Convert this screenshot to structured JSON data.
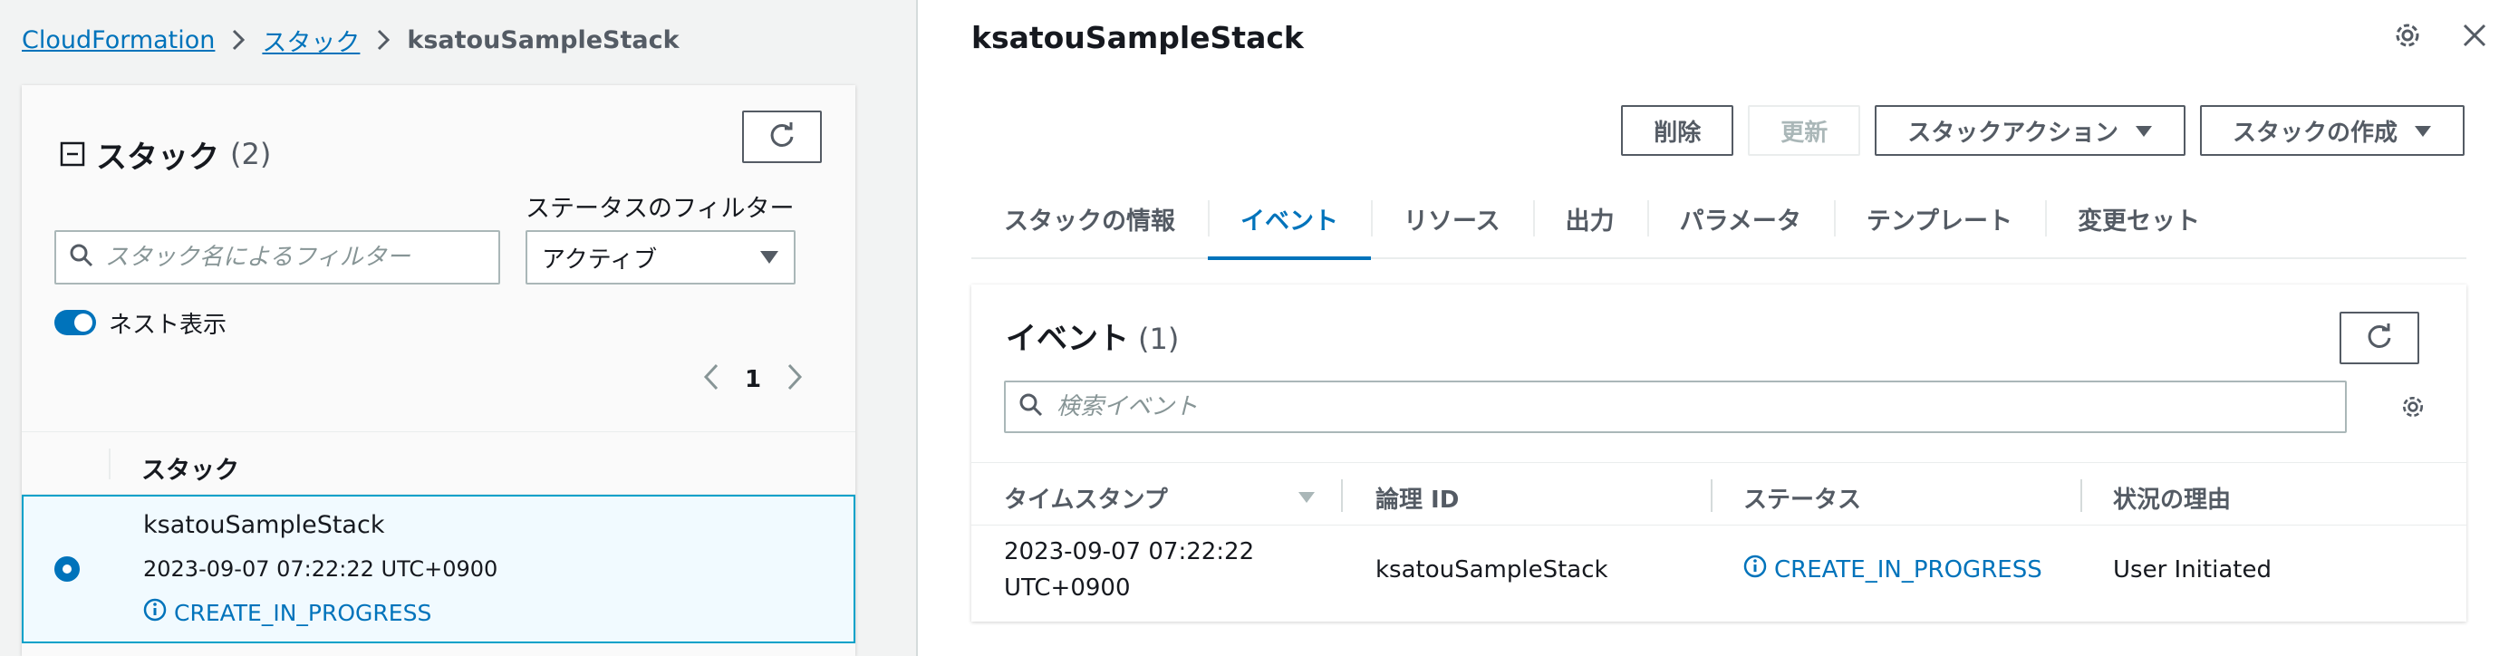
{
  "breadcrumb": {
    "root": "CloudFormation",
    "section": "スタック",
    "current": "ksatouSampleStack"
  },
  "stack_list": {
    "title": "スタック",
    "count": "(2)",
    "status_filter_label": "ステータスのフィルター",
    "search_placeholder": "スタック名によるフィルター",
    "status_filter_value": "アクティブ",
    "nested_toggle_label": "ネスト表示",
    "nested_toggle_on": true,
    "page_number": "1",
    "column_header": "スタック",
    "rows": [
      {
        "name": "ksatouSampleStack",
        "time": "2023-09-07 07:22:22 UTC+0900",
        "status": "CREATE_IN_PROGRESS",
        "selected": true
      }
    ]
  },
  "detail": {
    "title": "ksatouSampleStack",
    "buttons": {
      "delete": "削除",
      "update": "更新",
      "stack_actions": "スタックアクション",
      "create_stack": "スタックの作成"
    },
    "tabs": [
      {
        "label": "スタックの情報",
        "active": false
      },
      {
        "label": "イベント",
        "active": true
      },
      {
        "label": "リソース",
        "active": false
      },
      {
        "label": "出力",
        "active": false
      },
      {
        "label": "パラメータ",
        "active": false
      },
      {
        "label": "テンプレート",
        "active": false
      },
      {
        "label": "変更セット",
        "active": false
      }
    ],
    "events": {
      "title": "イベント",
      "count": "(1)",
      "search_placeholder": "検索イベント",
      "columns": {
        "timestamp": "タイムスタンプ",
        "logical_id": "論理 ID",
        "status": "ステータス",
        "reason": "状況の理由"
      },
      "rows": [
        {
          "timestamp_line1": "2023-09-07 07:22:22",
          "timestamp_line2": "UTC+0900",
          "logical_id": "ksatouSampleStack",
          "status": "CREATE_IN_PROGRESS",
          "reason": "User Initiated"
        }
      ]
    }
  },
  "colors": {
    "link": "#0073bb",
    "selected_row_bg": "#f1faff",
    "selected_row_border": "#00a1c9",
    "pane_bg": "#f2f3f3"
  },
  "icons": {
    "refresh": "refresh-icon",
    "search": "search-icon",
    "settings": "gear-icon",
    "close": "close-icon",
    "info": "info-icon",
    "collapse": "collapse-icon",
    "caret": "caret-down-icon"
  }
}
